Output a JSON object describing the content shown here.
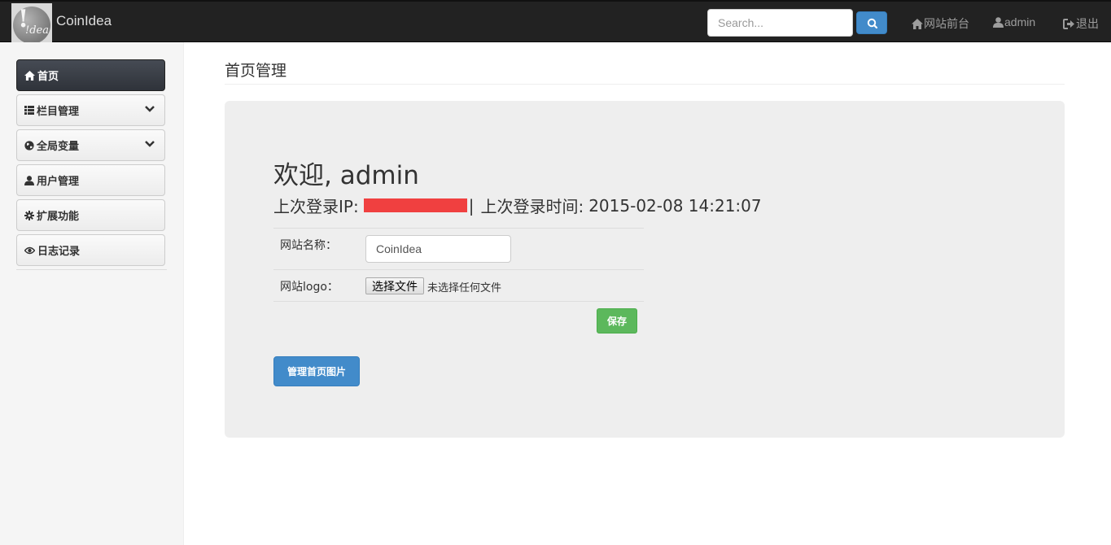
{
  "navbar": {
    "logo_text": "!dea",
    "brand": "CoinIdea",
    "search_placeholder": "Search...",
    "links": {
      "frontend": "网站前台",
      "user": "admin",
      "logout": "退出"
    }
  },
  "sidebar": {
    "items": [
      {
        "label": "首页",
        "icon": "home-icon",
        "active": true
      },
      {
        "label": "栏目管理",
        "icon": "list-icon",
        "expandable": true
      },
      {
        "label": "全局变量",
        "icon": "globe-icon",
        "expandable": true
      },
      {
        "label": "用户管理",
        "icon": "user-icon"
      },
      {
        "label": "扩展功能",
        "icon": "gear-icon"
      },
      {
        "label": "日志记录",
        "icon": "eye-icon"
      }
    ]
  },
  "main": {
    "title": "首页管理",
    "welcome": "欢迎, admin",
    "last_ip_label": "上次登录IP:",
    "separator": "|",
    "last_time_label": "上次登录时间:",
    "last_time_value": "2015-02-08 14:21:07",
    "form": {
      "site_name_label": "网站名称：",
      "site_name_value": "CoinIdea",
      "site_logo_label": "网站logo：",
      "file_button": "选择文件",
      "file_status": "未选择任何文件",
      "save_button": "保存"
    },
    "manage_images_button": "管理首页图片"
  },
  "colors": {
    "navbar_bg": "#222222",
    "primary": "#428bca",
    "success": "#5cb85c",
    "redaction": "#f04040"
  }
}
